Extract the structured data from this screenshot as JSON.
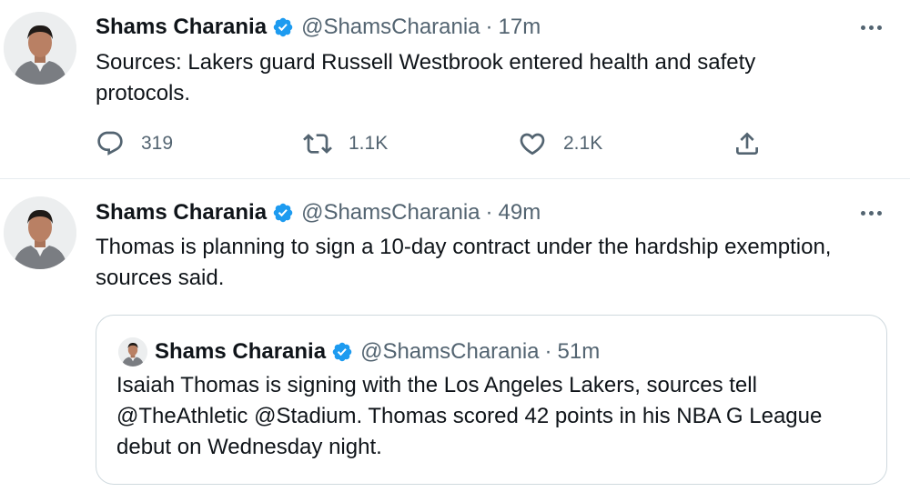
{
  "tweets": [
    {
      "author": {
        "name": "Shams Charania",
        "handle": "@ShamsCharania"
      },
      "separator": "·",
      "time": "17m",
      "text": "Sources: Lakers guard Russell Westbrook entered health and safety protocols.",
      "stats": {
        "replies": "319",
        "retweets": "1.1K",
        "likes": "2.1K"
      }
    },
    {
      "author": {
        "name": "Shams Charania",
        "handle": "@ShamsCharania"
      },
      "separator": "·",
      "time": "49m",
      "text": "Thomas is planning to sign a 10-day contract under the hardship exemption, sources said.",
      "quote": {
        "author": {
          "name": "Shams Charania",
          "handle": "@ShamsCharania"
        },
        "separator": "·",
        "time": "51m",
        "text": "Isaiah Thomas is signing with the Los Angeles Lakers, sources tell @TheAthletic @Stadium. Thomas scored 42 points in his NBA G League debut on Wednesday night."
      }
    }
  ],
  "icons": {
    "verified": "verified-badge-icon",
    "more": "more-options-icon",
    "reply": "reply-icon",
    "retweet": "retweet-icon",
    "like": "like-icon",
    "share": "share-icon"
  },
  "colors": {
    "verified": "#1d9bf0",
    "text": "#0f1419",
    "secondary": "#536471",
    "divider": "#e6ecf0",
    "quote_border": "#cfd9de"
  }
}
